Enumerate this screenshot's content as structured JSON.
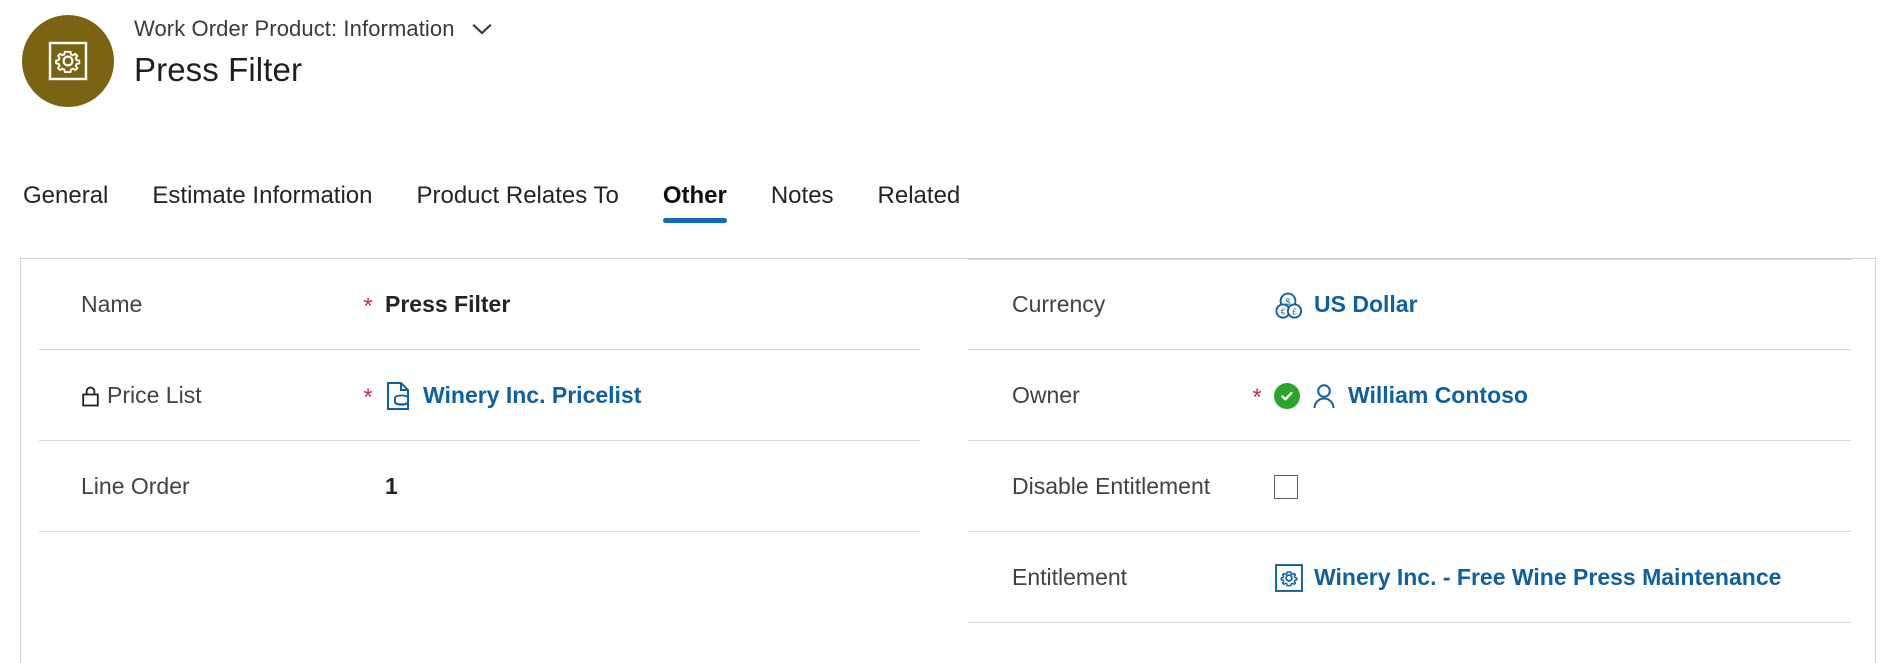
{
  "header": {
    "subtitle": "Work Order Product: Information",
    "title": "Press Filter",
    "avatar_icon": "gear-in-square-icon",
    "avatar_color": "#7a6414",
    "dropdown_icon": "chevron-down-icon"
  },
  "tabs": [
    {
      "label": "General",
      "active": false
    },
    {
      "label": "Estimate Information",
      "active": false
    },
    {
      "label": "Product Relates To",
      "active": false
    },
    {
      "label": "Other",
      "active": true
    },
    {
      "label": "Notes",
      "active": false
    },
    {
      "label": "Related",
      "active": false
    }
  ],
  "accent_color": "#0f6cbd",
  "link_color": "#11609e",
  "required_color": "#c4314b",
  "form": {
    "left_column": [
      {
        "label": "Name",
        "required": true,
        "lock": false,
        "value": "Press Filter",
        "type": "text",
        "icon": ""
      },
      {
        "label": "Price List",
        "required": true,
        "lock": true,
        "lock_icon": "lock-icon",
        "value": "Winery Inc. Pricelist",
        "type": "link",
        "icon": "pricelist-document-icon"
      },
      {
        "label": "Line Order",
        "required": false,
        "lock": false,
        "value": "1",
        "type": "text",
        "icon": ""
      }
    ],
    "right_column": [
      {
        "label": "Currency",
        "required": false,
        "lock": false,
        "value": "US Dollar",
        "type": "link",
        "icon": "currency-coins-icon"
      },
      {
        "label": "Owner",
        "required": true,
        "lock": false,
        "value": "William Contoso",
        "type": "link",
        "icon": "person-icon",
        "status_icon": "green-check-icon",
        "status_color": "#2aa42a"
      },
      {
        "label": "Disable Entitlement",
        "required": false,
        "lock": false,
        "value": "",
        "type": "checkbox",
        "checked": false,
        "icon": ""
      },
      {
        "label": "Entitlement",
        "required": false,
        "lock": false,
        "value": "Winery Inc. - Free Wine Press Maintenance",
        "type": "link",
        "icon": "gear-in-square-icon"
      }
    ]
  }
}
